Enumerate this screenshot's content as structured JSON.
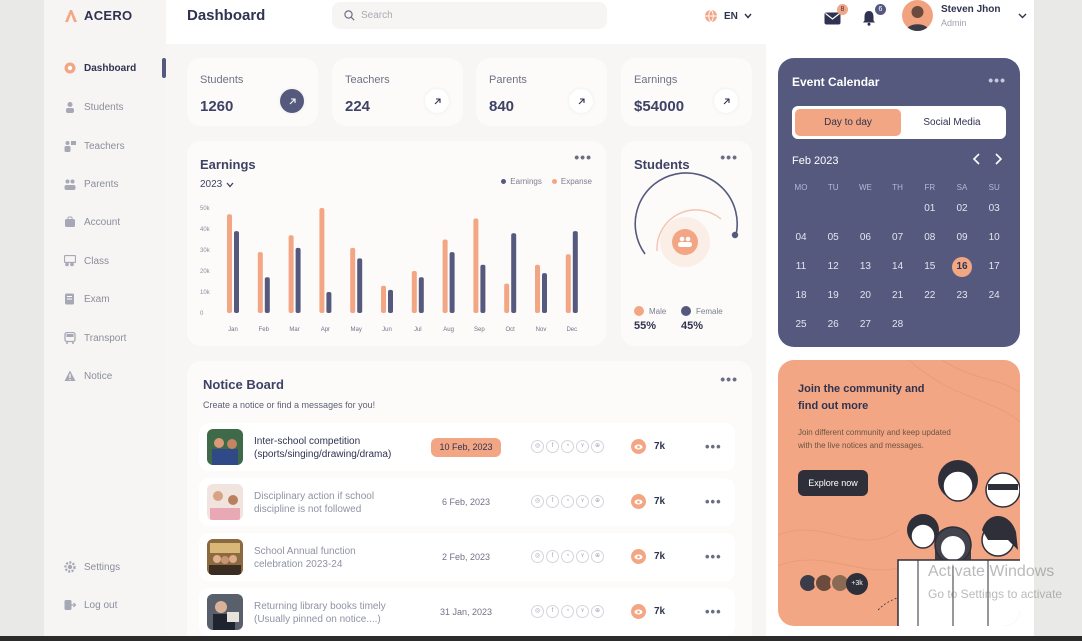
{
  "brand": {
    "name": "ACERO",
    "accent": "#f3a683",
    "navy": "#55597e"
  },
  "header": {
    "title": "Dashboard",
    "search_placeholder": "Search",
    "language": "EN",
    "messages_count": "8",
    "notifications_count": "6",
    "user_name": "Steven Jhon",
    "user_role": "Admin"
  },
  "sidebar": {
    "items": [
      {
        "label": "Dashboard",
        "icon": "dashboard-icon"
      },
      {
        "label": "Students",
        "icon": "student-icon"
      },
      {
        "label": "Teachers",
        "icon": "teacher-icon"
      },
      {
        "label": "Parents",
        "icon": "parents-icon"
      },
      {
        "label": "Account",
        "icon": "account-icon"
      },
      {
        "label": "Class",
        "icon": "class-icon"
      },
      {
        "label": "Exam",
        "icon": "exam-icon"
      },
      {
        "label": "Transport",
        "icon": "bus-icon"
      },
      {
        "label": "Notice",
        "icon": "warning-icon"
      }
    ],
    "settings": "Settings",
    "logout": "Log out"
  },
  "stats": [
    {
      "label": "Students",
      "value": "1260"
    },
    {
      "label": "Teachers",
      "value": "224"
    },
    {
      "label": "Parents",
      "value": "840"
    },
    {
      "label": "Earnings",
      "value": "$54000"
    }
  ],
  "earnings": {
    "title": "Earnings",
    "year": "2023",
    "legend_earnings": "Earnings",
    "legend_expanse": "Expanse"
  },
  "chart_data": {
    "type": "bar",
    "categories": [
      "Jan",
      "Feb",
      "Mar",
      "Apr",
      "May",
      "Jun",
      "Jul",
      "Aug",
      "Sep",
      "Oct",
      "Nov",
      "Dec"
    ],
    "series": [
      {
        "name": "Expanse",
        "color": "#f3a683",
        "values": [
          47,
          29,
          37,
          50,
          31,
          13,
          20,
          35,
          45,
          14,
          23,
          28
        ]
      },
      {
        "name": "Earnings",
        "color": "#55597e",
        "values": [
          39,
          17,
          31,
          10,
          26,
          11,
          17,
          29,
          23,
          38,
          19,
          39
        ]
      }
    ],
    "y_ticks": [
      "0",
      "10k",
      "20k",
      "30k",
      "40k",
      "50k"
    ],
    "ylim": [
      0,
      50
    ],
    "grid": false,
    "legend": "top-right"
  },
  "students_card": {
    "title": "Students",
    "male_label": "Male",
    "male_value": "55%",
    "female_label": "Female",
    "female_value": "45%"
  },
  "notice_board": {
    "title": "Notice Board",
    "subtitle": "Create a notice or find a messages for you!",
    "rows": [
      {
        "line1": "Inter-school competition",
        "line2": "(sports/singing/drawing/drama)",
        "date": "10 Feb, 2023",
        "views": "7k"
      },
      {
        "line1": "Disciplinary action if school",
        "line2": "discipline is not followed",
        "date": "6 Feb, 2023",
        "views": "7k"
      },
      {
        "line1": "School Annual function",
        "line2": "celebration 2023-24",
        "date": "2 Feb, 2023",
        "views": "7k"
      },
      {
        "line1": "Returning library books timely",
        "line2": "(Usually pinned on notice....)",
        "date": "31 Jan, 2023",
        "views": "7k"
      }
    ]
  },
  "calendar": {
    "title": "Event Calendar",
    "tab_active": "Day to day",
    "tab_other": "Social Media",
    "month": "Feb 2023",
    "weekdays": [
      "MO",
      "TU",
      "WE",
      "TH",
      "FR",
      "SA",
      "SU"
    ],
    "days": [
      "01",
      "02",
      "03",
      "04",
      "05",
      "06",
      "07",
      "08",
      "09",
      "10",
      "11",
      "12",
      "13",
      "14",
      "15",
      "16",
      "17",
      "18",
      "19",
      "20",
      "21",
      "22",
      "23",
      "24",
      "25",
      "26",
      "27",
      "28"
    ],
    "today": "16"
  },
  "community": {
    "title_line1": "Join the community and",
    "title_line2": "find out more",
    "sub_line1": "Join different community and keep updated",
    "sub_line2": "with the live notices and messages.",
    "button": "Explore now",
    "members_badge": "+3k"
  },
  "watermark": {
    "line1": "Activate Windows",
    "line2": "Go to Settings to activate"
  }
}
